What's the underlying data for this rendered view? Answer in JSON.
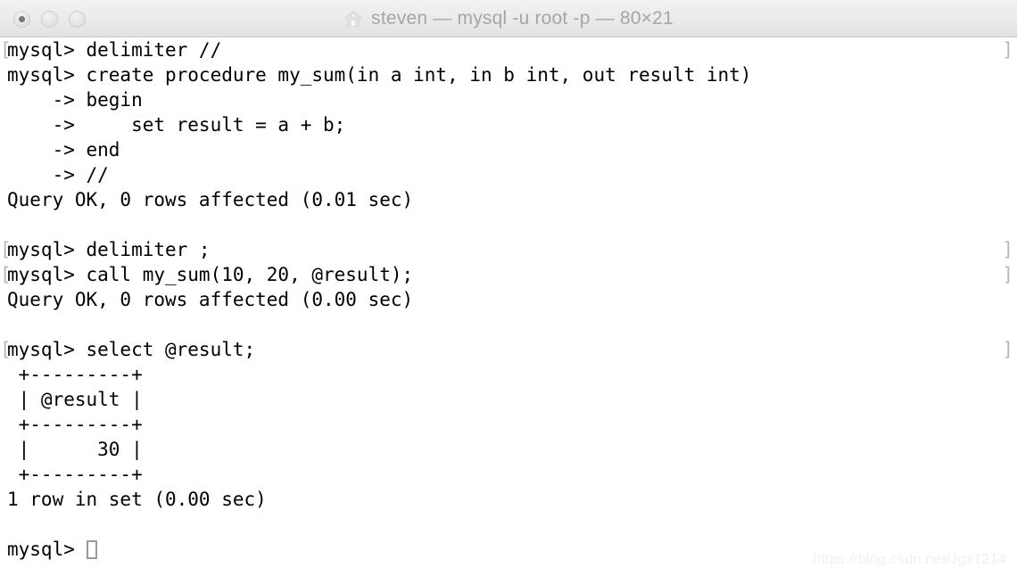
{
  "window": {
    "title": "steven — mysql -u root -p — 80×21",
    "home_icon": "home-icon",
    "traffic_lights": [
      {
        "name": "close-button",
        "label": ""
      },
      {
        "name": "minimize-button",
        "label": ""
      },
      {
        "name": "maximize-button",
        "label": ""
      }
    ],
    "background_color": "#ffffff",
    "titlebar_color": "#eaeaea",
    "title_text_color": "#a6a6a6",
    "terminal_text_color": "#000000",
    "prompt_mark_color": "#b8b8b8",
    "cursor_color": "#9a9a9a"
  },
  "terminal": {
    "columns": 80,
    "rows": 21,
    "prompt_mark_left": "[",
    "prompt_mark_right": "]",
    "cursor": "block-outline",
    "lines": [
      {
        "text": "mysql> delimiter //",
        "mark": true
      },
      {
        "text": "mysql> create procedure my_sum(in a int, in b int, out result int)",
        "mark": false
      },
      {
        "text": "    -> begin",
        "mark": false
      },
      {
        "text": "    ->     set result = a + b;",
        "mark": false
      },
      {
        "text": "    -> end",
        "mark": false
      },
      {
        "text": "    -> //",
        "mark": false
      },
      {
        "text": "Query OK, 0 rows affected (0.01 sec)",
        "mark": false
      },
      {
        "text": "",
        "mark": false
      },
      {
        "text": "mysql> delimiter ;",
        "mark": true
      },
      {
        "text": "mysql> call my_sum(10, 20, @result);",
        "mark": true
      },
      {
        "text": "Query OK, 0 rows affected (0.00 sec)",
        "mark": false
      },
      {
        "text": "",
        "mark": false
      },
      {
        "text": "mysql> select @result;",
        "mark": true
      },
      {
        "text": " +---------+",
        "mark": false
      },
      {
        "text": " | @result |",
        "mark": false
      },
      {
        "text": " +---------+",
        "mark": false
      },
      {
        "text": " |      30 |",
        "mark": false
      },
      {
        "text": " +---------+",
        "mark": false
      },
      {
        "text": "1 row in set (0.00 sec)",
        "mark": false
      },
      {
        "text": "",
        "mark": false
      },
      {
        "text": "mysql> ",
        "mark": false,
        "cursor": true
      }
    ]
  },
  "watermark": {
    "text": "https://blog.csdn.net/Jgx1214"
  }
}
